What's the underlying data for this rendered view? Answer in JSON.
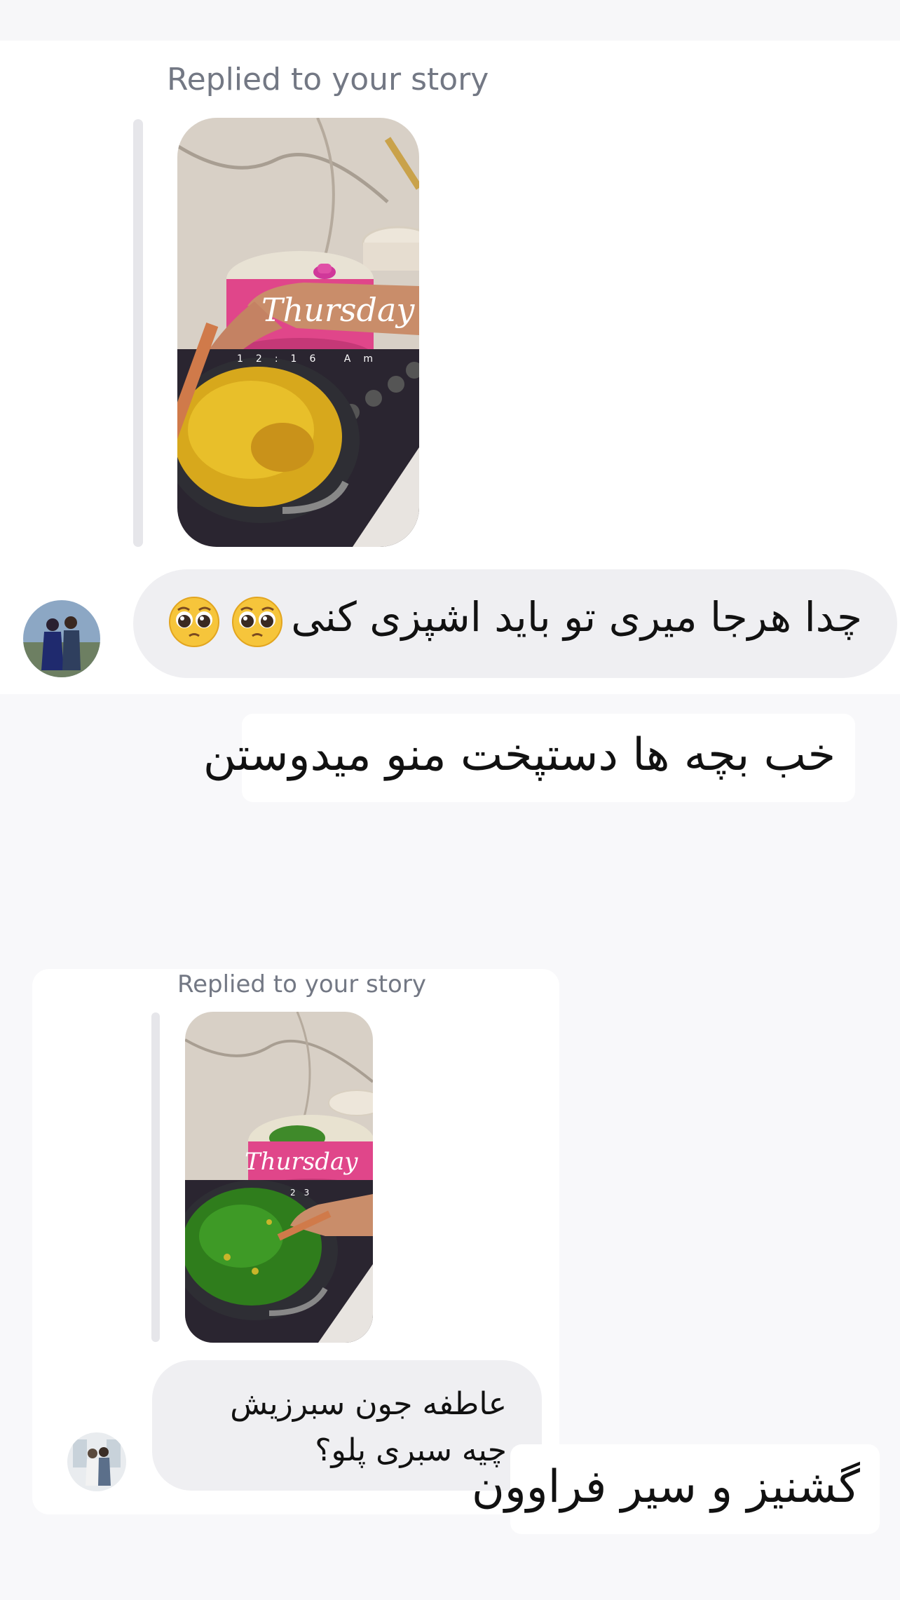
{
  "messages": [
    {
      "reply_label": "Replied to your story",
      "story_overlay": {
        "day": "Thursday",
        "time": "12:16 Am"
      },
      "text": "چدا هرجا میری تو باید اشپزی کنی",
      "emojis": [
        "pleading-face",
        "pleading-face"
      ]
    },
    {
      "text": "خب بچه ها دستپخت منو میدوستن"
    },
    {
      "reply_label": "Replied to your story",
      "story_overlay": {
        "day": "Thursday",
        "time": "23"
      },
      "text": "عاطفه جون سبرزیش چیه سبری پلو؟"
    },
    {
      "text": "گشنیز و سیر فراوون"
    }
  ],
  "colors": {
    "background": "#f8f8fa",
    "received_bubble": "#efeff2",
    "sent_bubble": "#ffffff",
    "label_gray": "#737884",
    "quote_bar": "#e6e6ea"
  }
}
